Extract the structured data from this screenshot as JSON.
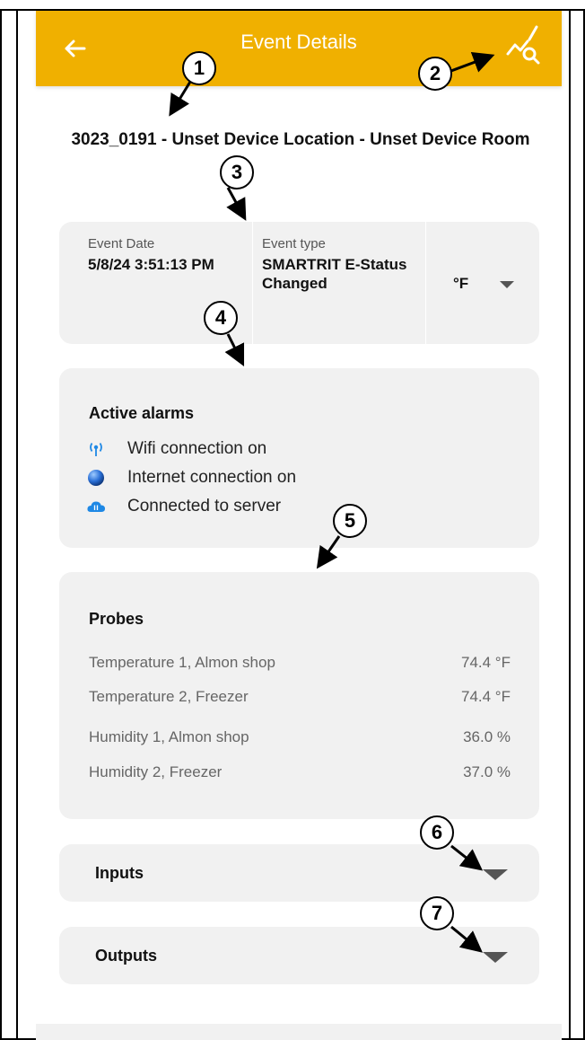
{
  "appbar": {
    "title": "Event Details",
    "back_icon": "back-arrow-icon",
    "graph_icon": "graph-search-icon",
    "background_color": "#f0b000"
  },
  "device_title": "3023_0191 - Unset Device Location - Unset Device Room",
  "event": {
    "date_label": "Event Date",
    "date_value": "5/8/24 3:51:13 PM",
    "type_label": "Event type",
    "type_value": "SMARTRIT E-Status Changed",
    "unit_value": "°F"
  },
  "alarms": {
    "title": "Active alarms",
    "items": [
      {
        "label": "Wifi connection on",
        "icon": "wifi-icon"
      },
      {
        "label": "Internet connection on",
        "icon": "globe-icon"
      },
      {
        "label": "Connected to server",
        "icon": "cloud-sync-icon"
      }
    ]
  },
  "probes": {
    "title": "Probes",
    "items": [
      {
        "name": "Temperature 1, Almon shop",
        "value": "74.4 °F"
      },
      {
        "name": "Temperature 2, Freezer",
        "value": "74.4 °F"
      },
      {
        "name": "Humidity 1, Almon shop",
        "value": "36.0 %"
      },
      {
        "name": "Humidity 2, Freezer",
        "value": "37.0 %"
      }
    ]
  },
  "inputs": {
    "title": "Inputs"
  },
  "outputs": {
    "title": "Outputs"
  },
  "callouts": [
    "1",
    "2",
    "3",
    "4",
    "5",
    "6",
    "7"
  ]
}
